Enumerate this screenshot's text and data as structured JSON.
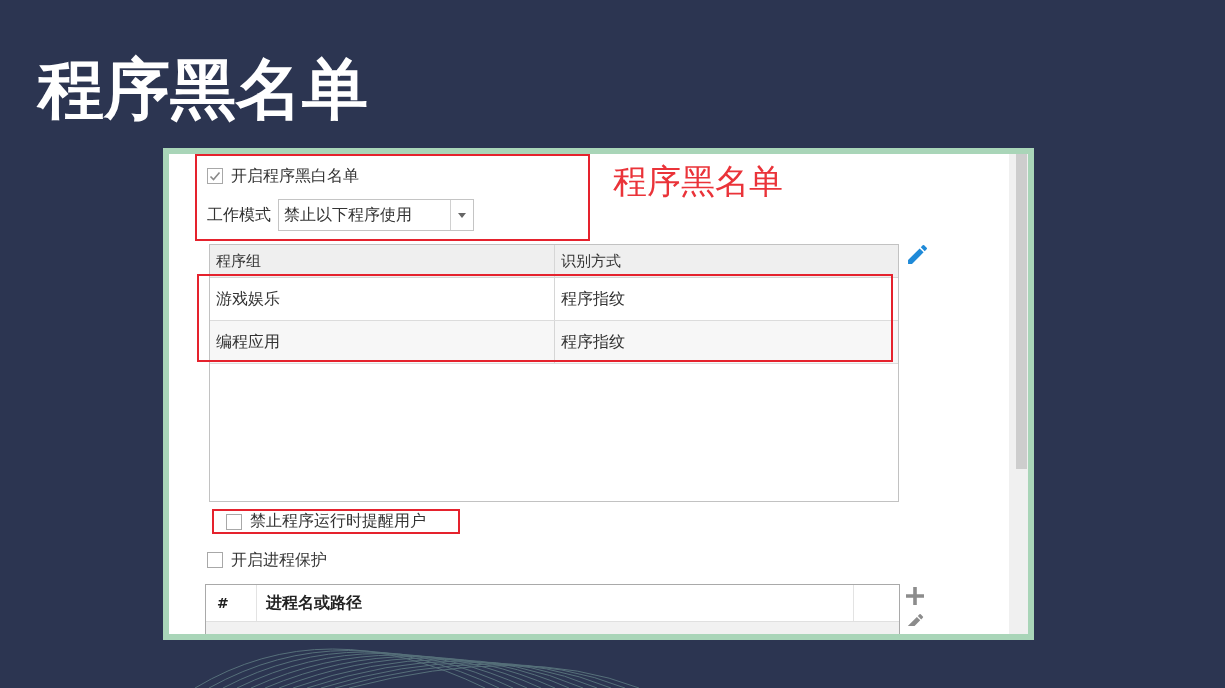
{
  "slide_title": "程序黑名单",
  "annotation_label": "程序黑名单",
  "mode_section": {
    "highlighted": true,
    "enable_list": {
      "label": "开启程序黑白名单",
      "checked": true
    },
    "work_mode": {
      "label": "工作模式",
      "value": "禁止以下程序使用"
    }
  },
  "program_table": {
    "columns": [
      "程序组",
      "识别方式"
    ],
    "rows_highlighted": true,
    "rows": [
      [
        "游戏娱乐",
        "程序指纹"
      ],
      [
        "编程应用",
        "程序指纹"
      ]
    ]
  },
  "notify_user": {
    "label": "禁止程序运行时提醒用户",
    "checked": false,
    "highlighted": true
  },
  "process_protection": {
    "label": "开启进程保护",
    "checked": false
  },
  "process_table": {
    "columns": [
      "#",
      "进程名或路径"
    ]
  }
}
